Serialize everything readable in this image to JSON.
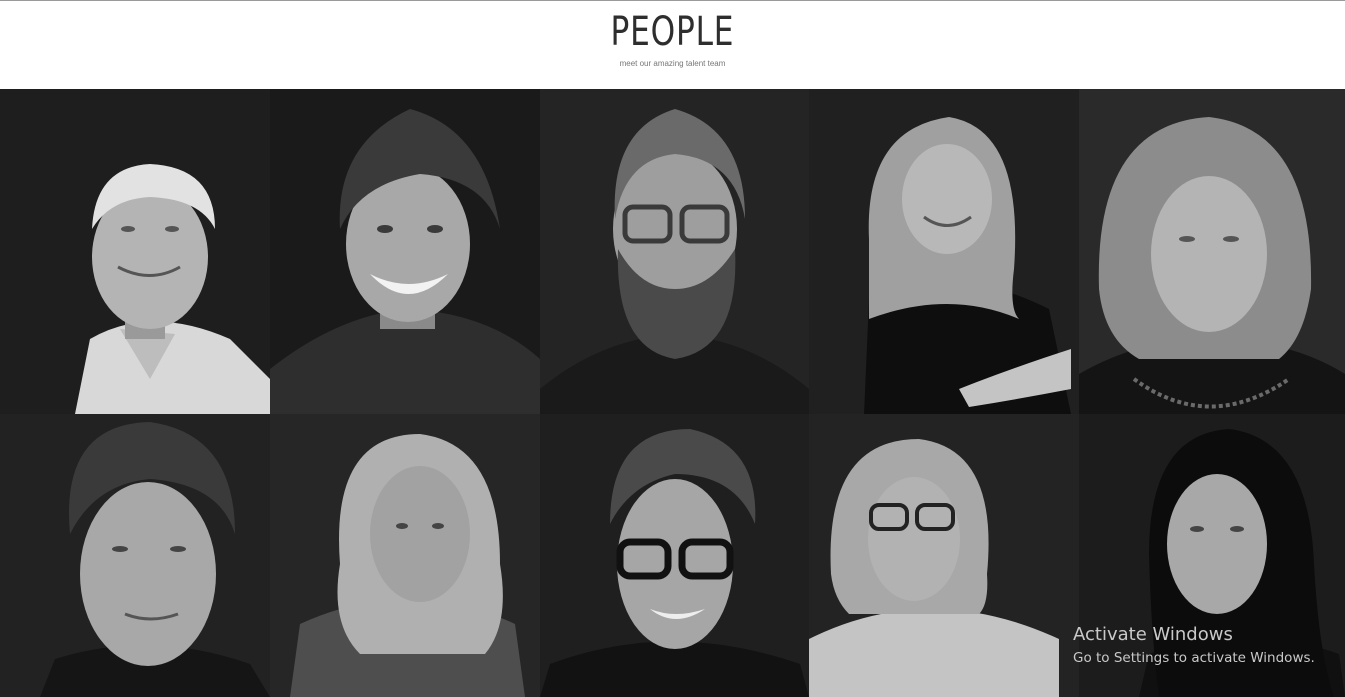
{
  "header": {
    "title": "PEOPLE",
    "subtitle": "meet our amazing talent team"
  },
  "people": [
    {
      "photo": "portrait-man-grey-hair-shirt"
    },
    {
      "photo": "portrait-man-smiling-dotted-shirt"
    },
    {
      "photo": "portrait-man-beard-glasses"
    },
    {
      "photo": "portrait-woman-black-turtleneck"
    },
    {
      "photo": "portrait-woman-necklace"
    },
    {
      "photo": "portrait-man-curly-hair"
    },
    {
      "photo": "portrait-woman-blonde-denim-shirt"
    },
    {
      "photo": "portrait-man-black-glasses"
    },
    {
      "photo": "portrait-woman-glasses-sweater"
    },
    {
      "photo": "portrait-woman-dark-hair"
    }
  ],
  "watermark": {
    "title": "Activate Windows",
    "subtitle": "Go to Settings to activate Windows."
  }
}
